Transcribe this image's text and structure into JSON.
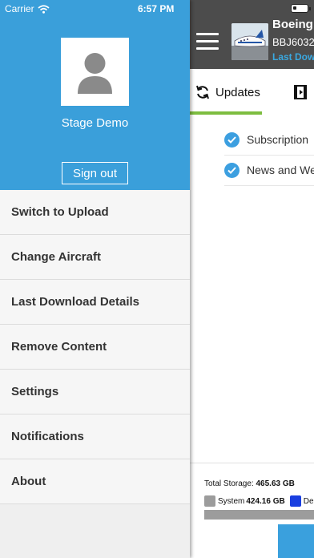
{
  "status_bar": {
    "carrier": "Carrier",
    "time": "6:57 PM"
  },
  "drawer": {
    "user_name": "Stage Demo",
    "sign_out_label": "Sign out",
    "menu_items": [
      "Switch to Upload",
      "Change Aircraft",
      "Last Download Details",
      "Remove Content",
      "Settings",
      "Notifications",
      "About"
    ]
  },
  "main": {
    "aircraft_title": "Boeing",
    "aircraft_sub": "BBJ6032",
    "last_download_label": "Last Dow",
    "tabs": {
      "updates_label": "Updates"
    },
    "checks": [
      "Subscription",
      "News and We"
    ],
    "storage": {
      "total_label": "Total Storage:",
      "total_value": "465.63 GB",
      "system_label": "System",
      "system_value": "424.16 GB",
      "other_label": "De"
    }
  },
  "colors": {
    "accent": "#3a9fda",
    "header_dark": "#4c4c4c",
    "tab_underline": "#7dbd3f",
    "system_swatch": "#9c9c9c",
    "other_swatch": "#1a3fe0"
  }
}
